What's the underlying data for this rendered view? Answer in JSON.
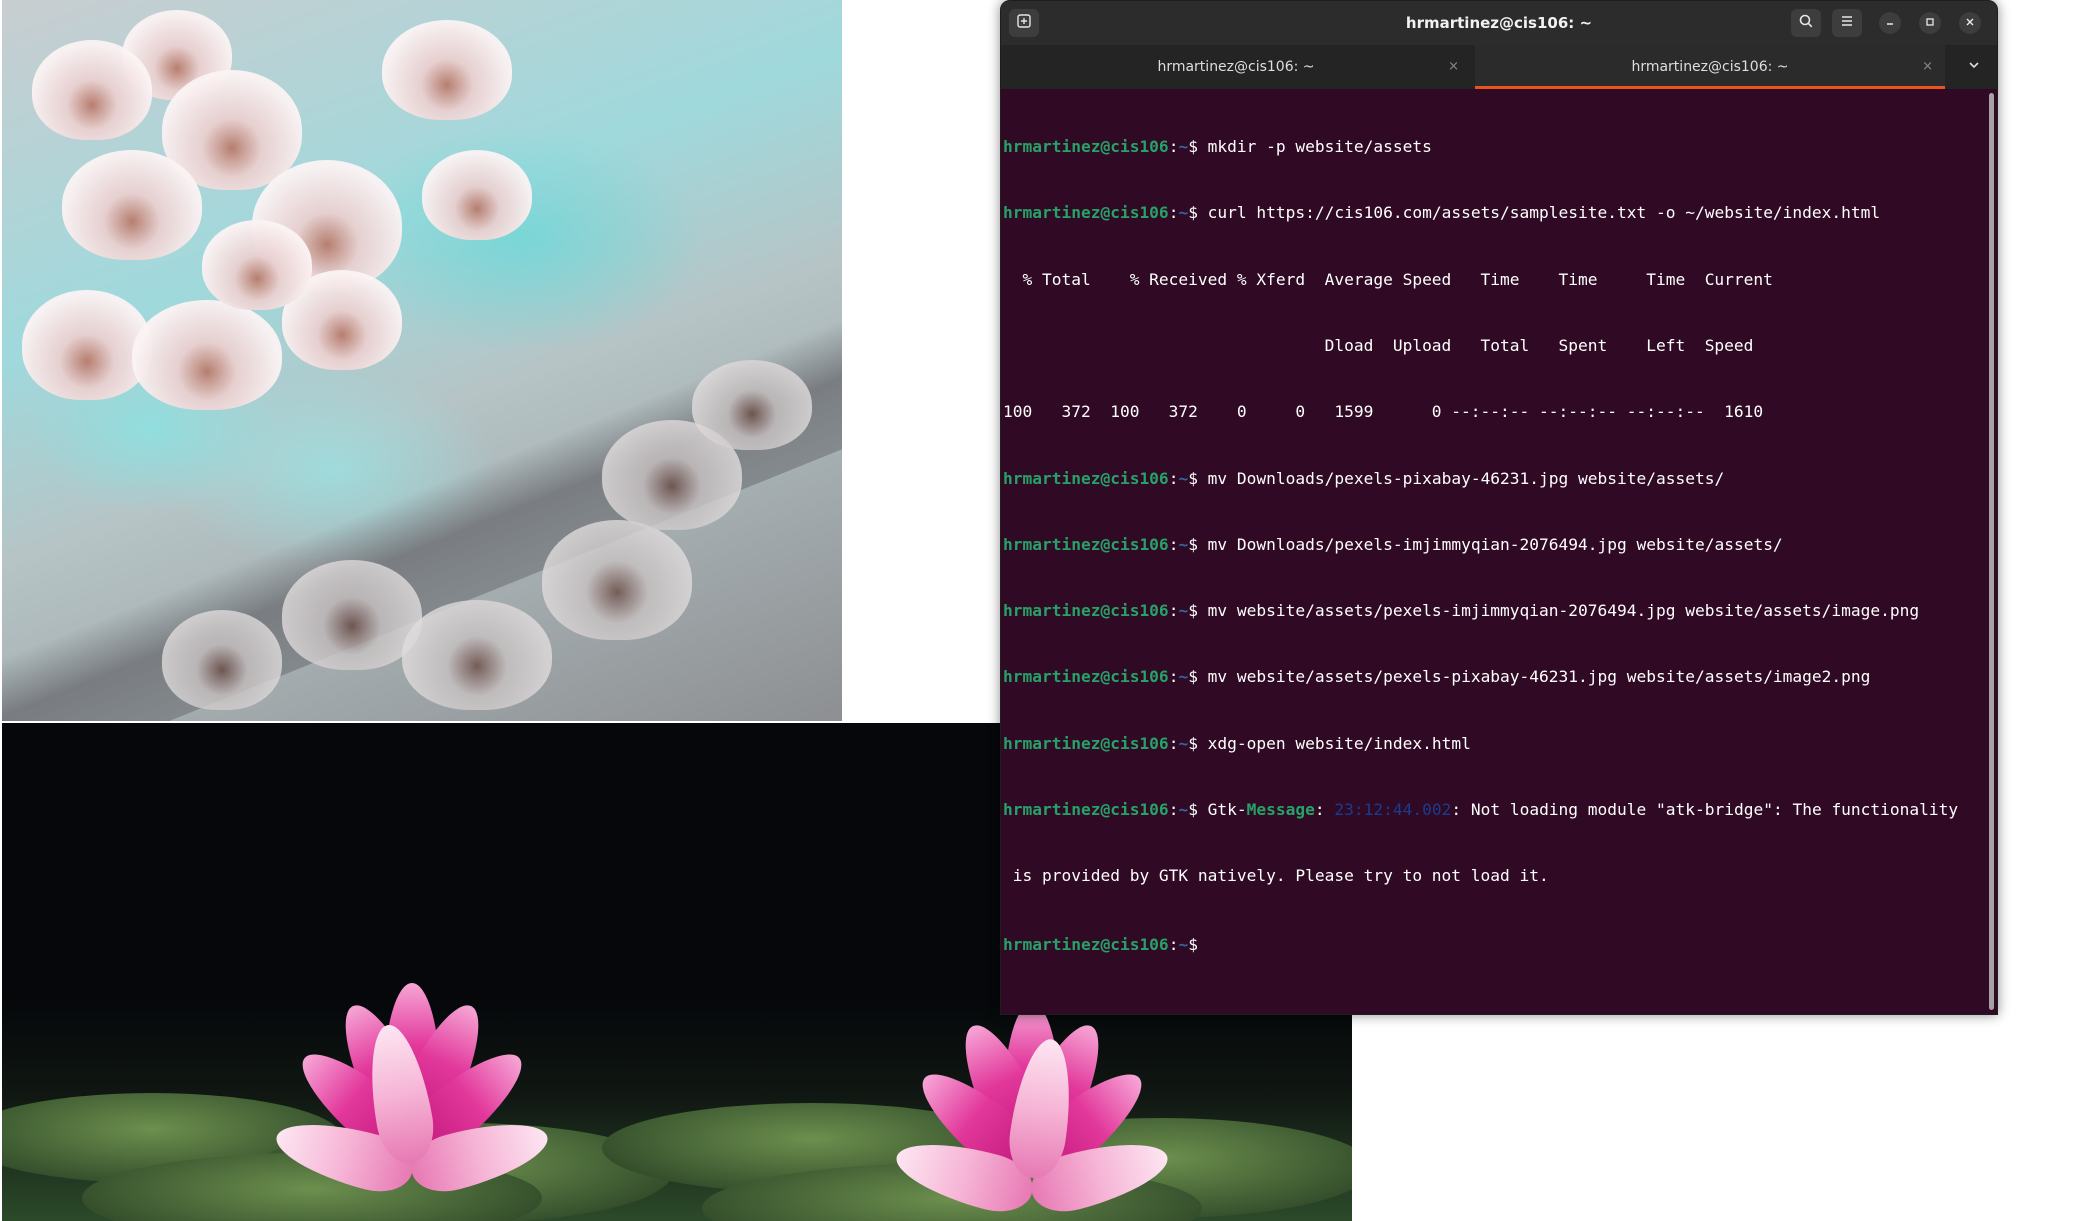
{
  "window": {
    "title": "hrmartinez@cis106: ~",
    "buttons": {
      "new_tab_icon": "new-tab-icon",
      "search_icon": "search-icon",
      "menu_icon": "hamburger-menu-icon",
      "minimize_icon": "minimize-icon",
      "maximize_icon": "maximize-icon",
      "close_icon": "close-icon"
    }
  },
  "tabs": [
    {
      "label": "hrmartinez@cis106: ~",
      "active": false,
      "close": "×"
    },
    {
      "label": "hrmartinez@cis106: ~",
      "active": true,
      "close": "×"
    }
  ],
  "tab_menu_icon": "chevron-down-icon",
  "prompt": {
    "user": "hrmartinez@cis106",
    "sep": ":",
    "path": "~",
    "symbol": "$"
  },
  "terminal": {
    "cmd1": " mkdir -p website/assets",
    "cmd2": " curl https://cis106.com/assets/samplesite.txt -o ~/website/index.html",
    "curl_header1": "  % Total    % Received % Xferd  Average Speed   Time    Time     Time  Current",
    "curl_header2": "                                 Dload  Upload   Total   Spent    Left  Speed",
    "curl_progress": "100   372  100   372    0     0   1599      0 --:--:-- --:--:-- --:--:--  1610",
    "cmd3": " mv Downloads/pexels-pixabay-46231.jpg website/assets/",
    "cmd4": " mv Downloads/pexels-imjimmyqian-2076494.jpg website/assets/",
    "cmd5": " mv website/assets/pexels-imjimmyqian-2076494.jpg website/assets/image.png",
    "cmd6": " mv website/assets/pexels-pixabay-46231.jpg website/assets/image2.png",
    "cmd7": " xdg-open website/index.html",
    "gtk_prefix": " Gtk-",
    "gtk_keyword": "Message",
    "gtk_colon": ": ",
    "gtk_timestamp": "23:12:44.002",
    "gtk_rest": ": Not loading module \"atk-bridge\": The functionality",
    "gtk_continued": " is provided by GTK natively. Please try to not load it."
  },
  "colors": {
    "terminal_bg": "#300a24",
    "prompt_user": "#26a269",
    "prompt_path": "#3465a4",
    "tab_accent": "#e95420"
  }
}
